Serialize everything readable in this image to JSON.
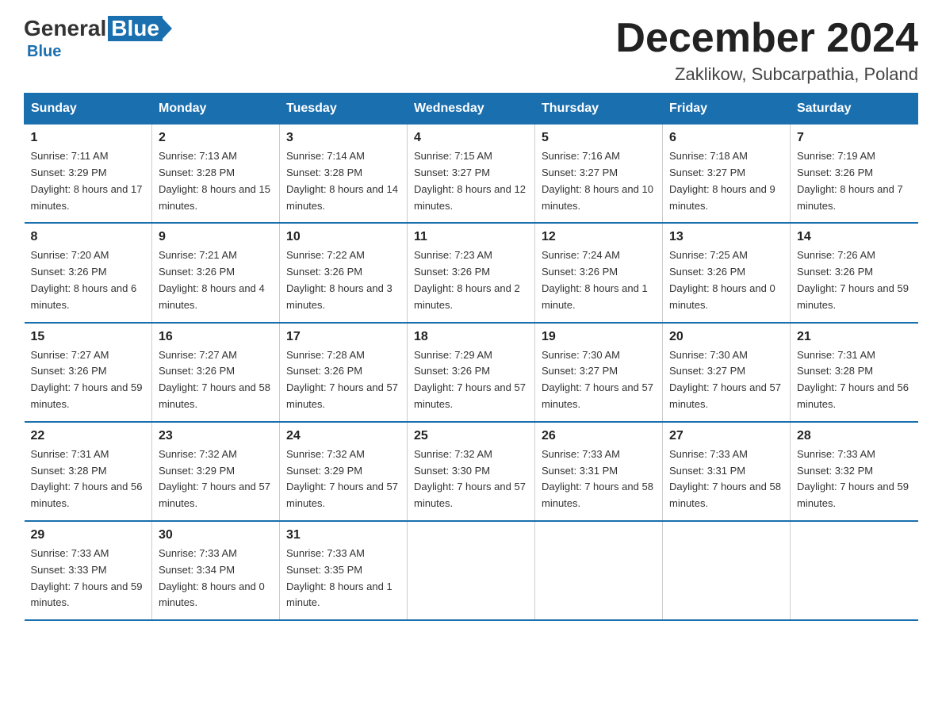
{
  "logo": {
    "general": "General",
    "blue": "Blue"
  },
  "title": "December 2024",
  "location": "Zaklikow, Subcarpathia, Poland",
  "days_of_week": [
    "Sunday",
    "Monday",
    "Tuesday",
    "Wednesday",
    "Thursday",
    "Friday",
    "Saturday"
  ],
  "weeks": [
    [
      {
        "day": "1",
        "sunrise": "7:11 AM",
        "sunset": "3:29 PM",
        "daylight": "8 hours and 17 minutes."
      },
      {
        "day": "2",
        "sunrise": "7:13 AM",
        "sunset": "3:28 PM",
        "daylight": "8 hours and 15 minutes."
      },
      {
        "day": "3",
        "sunrise": "7:14 AM",
        "sunset": "3:28 PM",
        "daylight": "8 hours and 14 minutes."
      },
      {
        "day": "4",
        "sunrise": "7:15 AM",
        "sunset": "3:27 PM",
        "daylight": "8 hours and 12 minutes."
      },
      {
        "day": "5",
        "sunrise": "7:16 AM",
        "sunset": "3:27 PM",
        "daylight": "8 hours and 10 minutes."
      },
      {
        "day": "6",
        "sunrise": "7:18 AM",
        "sunset": "3:27 PM",
        "daylight": "8 hours and 9 minutes."
      },
      {
        "day": "7",
        "sunrise": "7:19 AM",
        "sunset": "3:26 PM",
        "daylight": "8 hours and 7 minutes."
      }
    ],
    [
      {
        "day": "8",
        "sunrise": "7:20 AM",
        "sunset": "3:26 PM",
        "daylight": "8 hours and 6 minutes."
      },
      {
        "day": "9",
        "sunrise": "7:21 AM",
        "sunset": "3:26 PM",
        "daylight": "8 hours and 4 minutes."
      },
      {
        "day": "10",
        "sunrise": "7:22 AM",
        "sunset": "3:26 PM",
        "daylight": "8 hours and 3 minutes."
      },
      {
        "day": "11",
        "sunrise": "7:23 AM",
        "sunset": "3:26 PM",
        "daylight": "8 hours and 2 minutes."
      },
      {
        "day": "12",
        "sunrise": "7:24 AM",
        "sunset": "3:26 PM",
        "daylight": "8 hours and 1 minute."
      },
      {
        "day": "13",
        "sunrise": "7:25 AM",
        "sunset": "3:26 PM",
        "daylight": "8 hours and 0 minutes."
      },
      {
        "day": "14",
        "sunrise": "7:26 AM",
        "sunset": "3:26 PM",
        "daylight": "7 hours and 59 minutes."
      }
    ],
    [
      {
        "day": "15",
        "sunrise": "7:27 AM",
        "sunset": "3:26 PM",
        "daylight": "7 hours and 59 minutes."
      },
      {
        "day": "16",
        "sunrise": "7:27 AM",
        "sunset": "3:26 PM",
        "daylight": "7 hours and 58 minutes."
      },
      {
        "day": "17",
        "sunrise": "7:28 AM",
        "sunset": "3:26 PM",
        "daylight": "7 hours and 57 minutes."
      },
      {
        "day": "18",
        "sunrise": "7:29 AM",
        "sunset": "3:26 PM",
        "daylight": "7 hours and 57 minutes."
      },
      {
        "day": "19",
        "sunrise": "7:30 AM",
        "sunset": "3:27 PM",
        "daylight": "7 hours and 57 minutes."
      },
      {
        "day": "20",
        "sunrise": "7:30 AM",
        "sunset": "3:27 PM",
        "daylight": "7 hours and 57 minutes."
      },
      {
        "day": "21",
        "sunrise": "7:31 AM",
        "sunset": "3:28 PM",
        "daylight": "7 hours and 56 minutes."
      }
    ],
    [
      {
        "day": "22",
        "sunrise": "7:31 AM",
        "sunset": "3:28 PM",
        "daylight": "7 hours and 56 minutes."
      },
      {
        "day": "23",
        "sunrise": "7:32 AM",
        "sunset": "3:29 PM",
        "daylight": "7 hours and 57 minutes."
      },
      {
        "day": "24",
        "sunrise": "7:32 AM",
        "sunset": "3:29 PM",
        "daylight": "7 hours and 57 minutes."
      },
      {
        "day": "25",
        "sunrise": "7:32 AM",
        "sunset": "3:30 PM",
        "daylight": "7 hours and 57 minutes."
      },
      {
        "day": "26",
        "sunrise": "7:33 AM",
        "sunset": "3:31 PM",
        "daylight": "7 hours and 58 minutes."
      },
      {
        "day": "27",
        "sunrise": "7:33 AM",
        "sunset": "3:31 PM",
        "daylight": "7 hours and 58 minutes."
      },
      {
        "day": "28",
        "sunrise": "7:33 AM",
        "sunset": "3:32 PM",
        "daylight": "7 hours and 59 minutes."
      }
    ],
    [
      {
        "day": "29",
        "sunrise": "7:33 AM",
        "sunset": "3:33 PM",
        "daylight": "7 hours and 59 minutes."
      },
      {
        "day": "30",
        "sunrise": "7:33 AM",
        "sunset": "3:34 PM",
        "daylight": "8 hours and 0 minutes."
      },
      {
        "day": "31",
        "sunrise": "7:33 AM",
        "sunset": "3:35 PM",
        "daylight": "8 hours and 1 minute."
      },
      null,
      null,
      null,
      null
    ]
  ],
  "labels": {
    "sunrise": "Sunrise:",
    "sunset": "Sunset:",
    "daylight": "Daylight:"
  }
}
